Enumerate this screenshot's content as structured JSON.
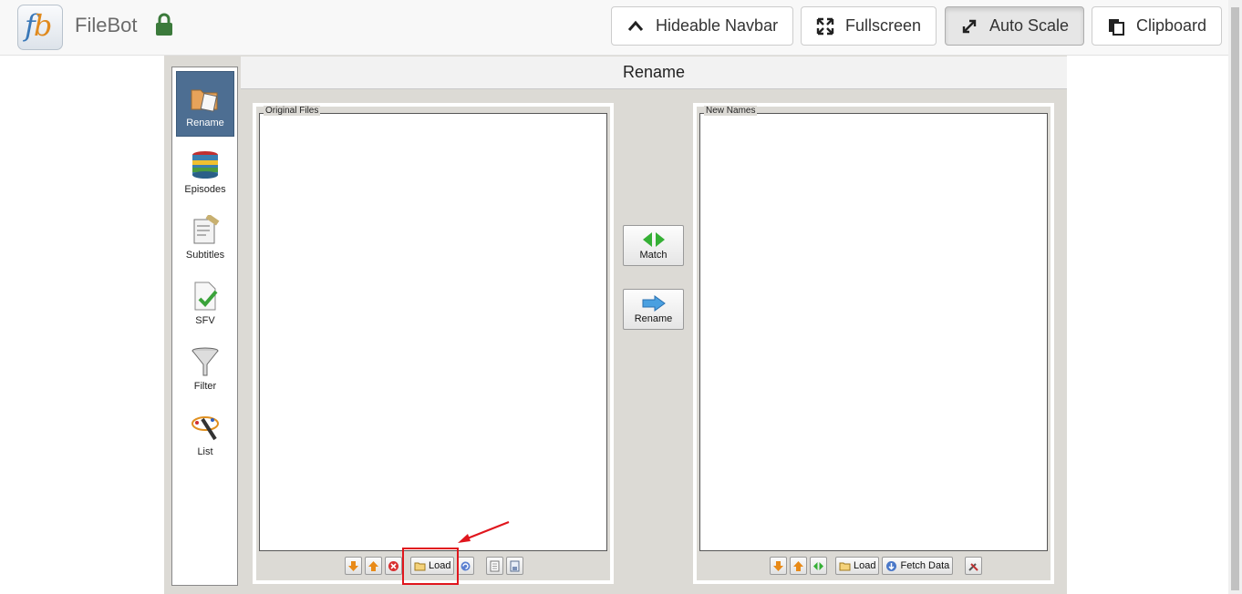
{
  "navbar": {
    "app_name": "FileBot",
    "logo_text_f": "f",
    "logo_text_b": "b",
    "buttons": [
      {
        "label": "Hideable Navbar",
        "icon": "chevron-up-icon"
      },
      {
        "label": "Fullscreen",
        "icon": "expand-icon"
      },
      {
        "label": "Auto Scale",
        "icon": "resize-arrows-icon",
        "active": true
      },
      {
        "label": "Clipboard",
        "icon": "clipboard-icon"
      }
    ]
  },
  "sidebar": {
    "items": [
      {
        "label": "Rename",
        "icon": "rename-folder-icon",
        "selected": true
      },
      {
        "label": "Episodes",
        "icon": "database-icon"
      },
      {
        "label": "Subtitles",
        "icon": "subtitles-icon"
      },
      {
        "label": "SFV",
        "icon": "checksum-icon"
      },
      {
        "label": "Filter",
        "icon": "funnel-icon"
      },
      {
        "label": "List",
        "icon": "magic-wand-icon"
      }
    ]
  },
  "main": {
    "title": "Rename",
    "original_files": {
      "legend": "Original Files",
      "load_label": "Load"
    },
    "new_names": {
      "legend": "New Names",
      "load_label": "Load",
      "fetch_label": "Fetch Data"
    },
    "match_label": "Match",
    "rename_label": "Rename"
  },
  "colors": {
    "annotation": "#e0161d",
    "sidebar_selected": "#4d6e92",
    "app_background": "#dcdad5"
  }
}
